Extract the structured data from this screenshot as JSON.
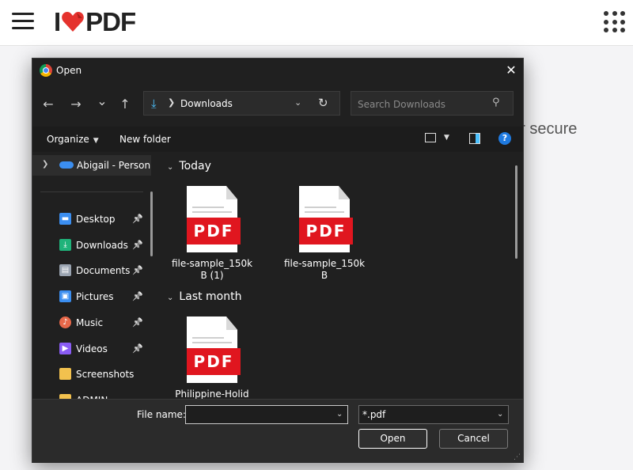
{
  "site": {
    "logo_left": "I",
    "logo_right": "PDF",
    "background_text": "ur secure"
  },
  "dialog": {
    "title": "Open",
    "close_glyph": "✕",
    "nav": {
      "back_glyph": "←",
      "forward_glyph": "→",
      "recent_glyph": "⌄",
      "up_glyph": "↑",
      "location": "Downloads",
      "search_placeholder": "Search Downloads"
    },
    "commands": {
      "organize": "Organize",
      "new_folder": "New folder",
      "help": "?"
    },
    "sidebar": {
      "top_item": "Abigail - Person",
      "items": [
        {
          "label": "Desktop",
          "icon": "desktop-icon",
          "pinned": true,
          "color": "#3b8ef0"
        },
        {
          "label": "Downloads",
          "icon": "downloads-icon",
          "pinned": true,
          "color": "#1fb37a"
        },
        {
          "label": "Documents",
          "icon": "documents-icon",
          "pinned": true,
          "color": "#9aa4b1"
        },
        {
          "label": "Pictures",
          "icon": "pictures-icon",
          "pinned": true,
          "color": "#3b8ef0"
        },
        {
          "label": "Music",
          "icon": "music-icon",
          "pinned": true,
          "color": "#e8684a"
        },
        {
          "label": "Videos",
          "icon": "videos-icon",
          "pinned": true,
          "color": "#8a5cf5"
        },
        {
          "label": "Screenshots",
          "icon": "folder-icon",
          "pinned": false,
          "color": "#f2c14e"
        },
        {
          "label": "ADMIN",
          "icon": "folder-icon",
          "pinned": false,
          "color": "#f2c14e"
        }
      ]
    },
    "groups": [
      {
        "label": "Today",
        "files": [
          {
            "name_line1": "file-sample_150k",
            "name_line2": "B (1)",
            "badge": "PDF"
          },
          {
            "name_line1": "file-sample_150k",
            "name_line2": "B",
            "badge": "PDF"
          }
        ]
      },
      {
        "label": "Last month",
        "files": [
          {
            "name_line1": "Philippine-Holid",
            "name_line2": "",
            "badge": "PDF"
          }
        ]
      }
    ],
    "footer": {
      "file_name_label": "File name:",
      "file_name_value": "",
      "file_type": "*.pdf",
      "open_label": "Open",
      "cancel_label": "Cancel"
    }
  },
  "colors": {
    "accent": "#4cc2ff",
    "pdf_red": "#e0161f",
    "dialog_bg": "#202020"
  }
}
